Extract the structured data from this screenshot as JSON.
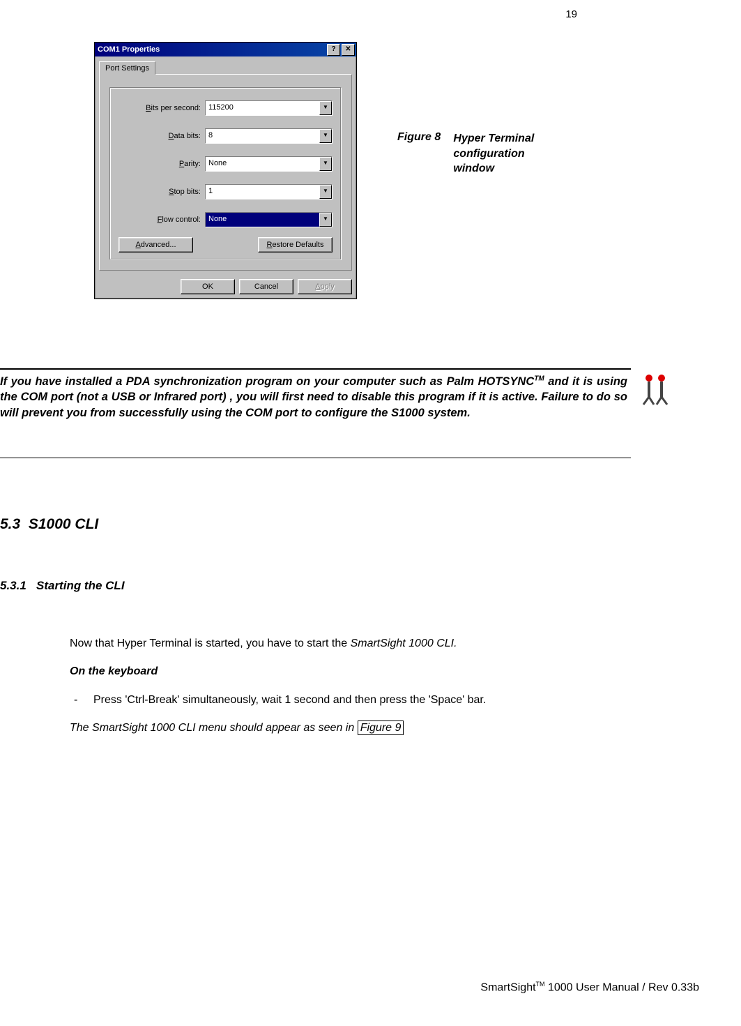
{
  "page_number": "19",
  "dialog": {
    "title": "COM1 Properties",
    "help_btn": "?",
    "close_btn": "✕",
    "tab": "Port Settings",
    "fields": {
      "bits_label": "Bits per second:",
      "bits_value": "115200",
      "data_label": "Data bits:",
      "data_value": "8",
      "parity_label": "Parity:",
      "parity_value": "None",
      "stop_label": "Stop bits:",
      "stop_value": "1",
      "flow_label": "Flow control:",
      "flow_value": "None"
    },
    "advanced": "Advanced...",
    "restore": "Restore Defaults",
    "ok": "OK",
    "cancel": "Cancel",
    "apply": "Apply"
  },
  "figure_caption": {
    "label": "Figure 8",
    "text": "Hyper Terminal\nconfiguration\nwindow"
  },
  "note": {
    "line1": "If you have installed a PDA synchronization program on your computer such as Palm HOTSYNC",
    "tm": "TM",
    "line2": " and it is using the COM port (not a USB or Infrared port) , you will first need to disable this program if it is active.  Failure to do so will prevent you from successfully using the COM port to configure the S1000 system."
  },
  "section": {
    "num": "5.3",
    "title": "S1000 CLI"
  },
  "subsection": {
    "num": "5.3.1",
    "title": "Starting the CLI"
  },
  "body": {
    "p1a": "Now that Hyper Terminal is started, you have to start the ",
    "p1b": "SmartSight 1000 CLI.",
    "p2": "On the keyboard",
    "bullet": "Press 'Ctrl-Break' simultaneously, wait 1 second and then press the 'Space' bar.",
    "p3a": "The SmartSight 1000 CLI menu should appear as seen in ",
    "figref": "Figure 9"
  },
  "footer": {
    "a": "SmartSight",
    "tm": "TM",
    "b": " 1000 User Manual / Rev 0.33b"
  }
}
